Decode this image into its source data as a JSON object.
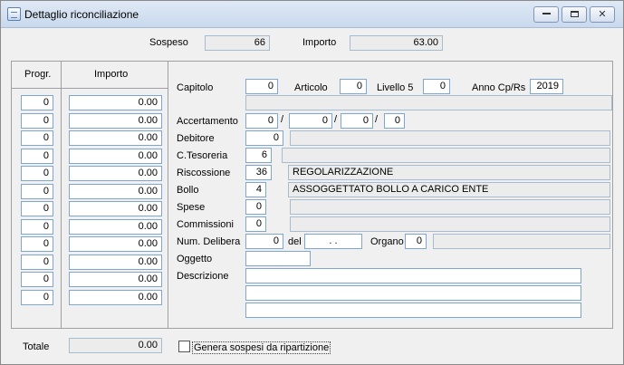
{
  "window": {
    "title": "Dettaglio riconciliazione"
  },
  "header": {
    "sospeso_label": "Sospeso",
    "sospeso_value": "66",
    "importo_label": "Importo",
    "importo_value": "63.00"
  },
  "grid": {
    "col_progr": "Progr.",
    "col_importo": "Importo",
    "rows": [
      {
        "progr": "0",
        "importo": "0.00"
      },
      {
        "progr": "0",
        "importo": "0.00"
      },
      {
        "progr": "0",
        "importo": "0.00"
      },
      {
        "progr": "0",
        "importo": "0.00"
      },
      {
        "progr": "0",
        "importo": "0.00"
      },
      {
        "progr": "0",
        "importo": "0.00"
      },
      {
        "progr": "0",
        "importo": "0.00"
      },
      {
        "progr": "0",
        "importo": "0.00"
      },
      {
        "progr": "0",
        "importo": "0.00"
      },
      {
        "progr": "0",
        "importo": "0.00"
      },
      {
        "progr": "0",
        "importo": "0.00"
      },
      {
        "progr": "0",
        "importo": "0.00"
      }
    ]
  },
  "detail": {
    "capitolo_label": "Capitolo",
    "capitolo_value": "0",
    "articolo_label": "Articolo",
    "articolo_value": "0",
    "livello_label": "Livello 5",
    "livello_value": "0",
    "anno_label": "Anno Cp/Rs",
    "anno_value": "2019",
    "capitolo_desc": "",
    "accertamento_label": "Accertamento",
    "accertamento_values": [
      "0",
      "0",
      "0",
      "0"
    ],
    "accertamento_sep": "/",
    "debitore_label": "Debitore",
    "debitore_value": "0",
    "debitore_desc": "",
    "tesoreria_label": "C.Tesoreria",
    "tesoreria_value": "6",
    "tesoreria_desc": "",
    "riscossione_label": "Riscossione",
    "riscossione_value": "36",
    "riscossione_desc": "REGOLARIZZAZIONE",
    "bollo_label": "Bollo",
    "bollo_value": "4",
    "bollo_desc": "ASSOGGETTATO BOLLO A CARICO ENTE",
    "spese_label": "Spese",
    "spese_value": "0",
    "spese_desc": "",
    "commissioni_label": "Commissioni",
    "commissioni_value": "0",
    "commissioni_desc": "",
    "delibera_label": "Num. Delibera",
    "delibera_value": "0",
    "del_label": "del",
    "del_value": ". .",
    "organo_label": "Organo",
    "organo_value": "0",
    "organo_desc": "",
    "oggetto_label": "Oggetto",
    "oggetto_value": "",
    "descrizione_label": "Descrizione",
    "descrizione_lines": [
      "",
      "",
      ""
    ]
  },
  "footer": {
    "totale_label": "Totale",
    "totale_value": "0.00",
    "genera_label": "Genera sospesi da ripartizione"
  }
}
